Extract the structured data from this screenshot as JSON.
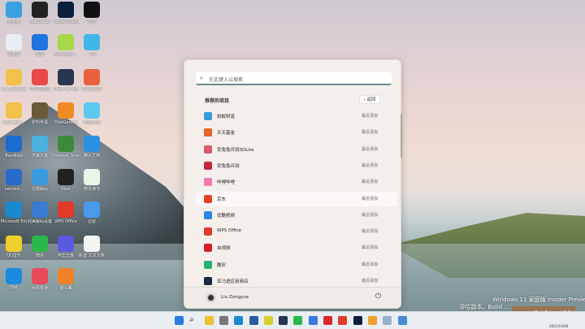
{
  "desktop": {
    "icons": [
      {
        "label": "此电脑",
        "color": "#3aa0e0"
      },
      {
        "label": "Wallpaper",
        "color": "#222"
      },
      {
        "label": "Adobe Photoshop",
        "color": "#0b1f3a"
      },
      {
        "label": "抖音",
        "color": "#111"
      },
      {
        "label": "回收站",
        "color": "#e8eef2"
      },
      {
        "label": "迅雷",
        "color": "#1f74e0"
      },
      {
        "label": "AnimalDe...",
        "color": "#a6d84a"
      },
      {
        "label": "飞书",
        "color": "#3fb6e6"
      },
      {
        "label": "Liu Zongyue",
        "color": "#f2c14b"
      },
      {
        "label": "华为浏览器",
        "color": "#e84a4a"
      },
      {
        "label": "Clash for Windows",
        "color": "#2a3550"
      },
      {
        "label": "开心消消乐",
        "color": "#e8603c"
      },
      {
        "label": "Microsoft...",
        "color": "#f2c14b"
      },
      {
        "label": "炉石传说",
        "color": "#6a5a3a"
      },
      {
        "label": "DiskGenius",
        "color": "#f08a24"
      },
      {
        "label": "哔哩哔哩",
        "color": "#5cc8f0"
      },
      {
        "label": "Bandizip",
        "color": "#1a6ad0"
      },
      {
        "label": "天翼云盘",
        "color": "#4ab0e0"
      },
      {
        "label": "Internet Downloa...",
        "color": "#3a8a3a"
      },
      {
        "label": "腾讯文档",
        "color": "#2a90e0"
      },
      {
        "label": "Lenovo...",
        "color": "#2a6ac8"
      },
      {
        "label": "优酷解码",
        "color": "#3a9ae0"
      },
      {
        "label": "Xbox",
        "color": "#222"
      },
      {
        "label": "微信读书",
        "color": "#e8f4e8"
      },
      {
        "label": "Microsoft Edge",
        "color": "#1a8ad0"
      },
      {
        "label": "完美解码设置",
        "color": "#3a7ad0"
      },
      {
        "label": "WPS Office",
        "color": "#e03a2a"
      },
      {
        "label": "迅雷",
        "color": "#4a9ae8"
      },
      {
        "label": "QQ音乐",
        "color": "#f0d02a"
      },
      {
        "label": "微信",
        "color": "#2ab84a"
      },
      {
        "label": "阿里云盘",
        "color": "#5a5ae0"
      },
      {
        "label": "新建 文本文档.txt",
        "color": "#f4f4f4"
      },
      {
        "label": "TIM",
        "color": "#1a8ae0"
      },
      {
        "label": "网易有道",
        "color": "#e84a5a"
      },
      {
        "label": "猫头鹰",
        "color": "#f0802a"
      }
    ]
  },
  "start_menu": {
    "search_placeholder": "在此键入以搜索",
    "section_title": "推荐的项目",
    "back_label": "返回",
    "items": [
      {
        "name": "蚂蚁财富",
        "time": "最近添加",
        "color": "#3a9ae0"
      },
      {
        "name": "天天基金",
        "time": "最近添加",
        "color": "#e8602a"
      },
      {
        "name": "安兔兔评测3DLite",
        "time": "最近添加",
        "color": "#d85a6a"
      },
      {
        "name": "安兔兔评测",
        "time": "最近添加",
        "color": "#c8283a"
      },
      {
        "name": "哔哩哔哩",
        "time": "最近添加",
        "color": "#f07ab0"
      },
      {
        "name": "京东",
        "time": "最近添加",
        "color": "#e8402a"
      },
      {
        "name": "优酷视频",
        "time": "最近添加",
        "color": "#2a8ae0"
      },
      {
        "name": "WPS Office",
        "time": "最近添加",
        "color": "#e03a2a"
      },
      {
        "name": "央视频",
        "time": "最近添加",
        "color": "#d8202a"
      },
      {
        "name": "酷安",
        "time": "最近添加",
        "color": "#2ab06a"
      },
      {
        "name": "亚马逊应用商店",
        "time": "最近添加",
        "color": "#1a2a3a"
      }
    ],
    "user": "Liu Zongyue"
  },
  "taskbar": {
    "icons": [
      {
        "name": "start",
        "color": "#2a7ae0"
      },
      {
        "name": "search",
        "color": "#333"
      },
      {
        "name": "file-explorer",
        "color": "#f0c030"
      },
      {
        "name": "settings",
        "color": "#777"
      },
      {
        "name": "edge",
        "color": "#1a8ad0"
      },
      {
        "name": "store",
        "color": "#2a5aa0"
      },
      {
        "name": "qq-music",
        "color": "#d8d02a"
      },
      {
        "name": "clash",
        "color": "#2a3550"
      },
      {
        "name": "wechat",
        "color": "#2ab84a"
      },
      {
        "name": "feishu",
        "color": "#3a7ae0"
      },
      {
        "name": "it-home",
        "color": "#d82a2a"
      },
      {
        "name": "wps",
        "color": "#e03a2a"
      },
      {
        "name": "photoshop",
        "color": "#0b1f3a"
      },
      {
        "name": "mayi",
        "color": "#f0a030"
      },
      {
        "name": "photos",
        "color": "#9ab0d0"
      },
      {
        "name": "notepad",
        "color": "#4a8ad0"
      }
    ]
  },
  "watermark": {
    "line1": "Windows 11 家庭版 Insider Preview",
    "line2": "评估副本。Build ...",
    "brand": "百度知道",
    "date": "2021/10/28"
  }
}
